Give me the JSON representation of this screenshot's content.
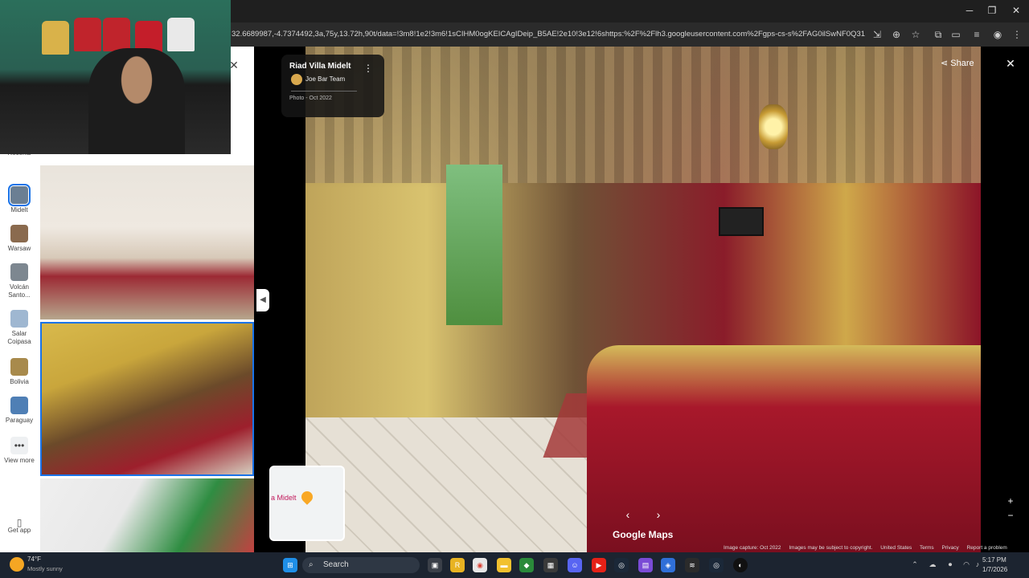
{
  "browser": {
    "address_bar": "32.6689987,-4.7374492,3a,75y,13.72h,90t/data=!3m8!1e2!3m6!1sCIHM0ogKEICAgIDeip_B5AE!2e10!3e12!6shttps:%2F%2Flh3.googleusercontent.com%2Fgps-cs-s%2FAG0ilSwNF0Q31i9bB-..."
  },
  "rail": {
    "items": [
      {
        "label": "Recents"
      },
      {
        "label": "Midelt"
      },
      {
        "label": "Warsaw"
      },
      {
        "label": "Volcán Santo..."
      },
      {
        "label": "Salar Coipasa"
      },
      {
        "label": "Bolivia"
      },
      {
        "label": "Paraguay"
      },
      {
        "label": "View more"
      },
      {
        "label": "Get app"
      }
    ]
  },
  "viewer": {
    "place_name": "Riad Villa Midelt",
    "author": "Joe Bar Team",
    "photo_date": "Photo - Oct 2022",
    "share_label": "Share",
    "logo": "Google Maps",
    "minimap_label": "a Midelt",
    "footer": {
      "capture": "Image capture: Oct 2022",
      "copyright": "Images may be subject to copyright.",
      "region": "United States",
      "terms": "Terms",
      "privacy": "Privacy",
      "report": "Report a problem"
    }
  },
  "taskbar": {
    "weather_temp": "74°F",
    "weather_desc": "Mostly sunny",
    "search_label": "Search",
    "time": "5:17 PM",
    "date": "1/7/2026"
  }
}
